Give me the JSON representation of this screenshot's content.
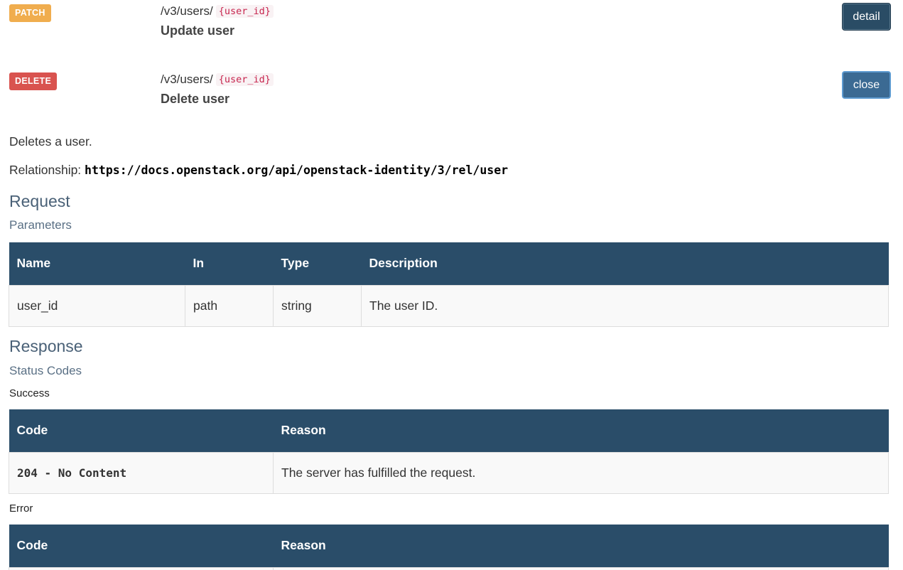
{
  "endpoints": [
    {
      "method": "PATCH",
      "path_prefix": "/v3/users/",
      "path_param": "{user_id}",
      "summary": "Update user",
      "button_label": "detail"
    },
    {
      "method": "DELETE",
      "path_prefix": "/v3/users/",
      "path_param": "{user_id}",
      "summary": "Delete user",
      "button_label": "close"
    }
  ],
  "detail": {
    "description": "Deletes a user.",
    "relationship_label": "Relationship:",
    "relationship_url": "https://docs.openstack.org/api/openstack-identity/3/rel/user",
    "request_heading": "Request",
    "parameters_heading": "Parameters",
    "parameters_table": {
      "headers": [
        "Name",
        "In",
        "Type",
        "Description"
      ],
      "rows": [
        [
          "user_id",
          "path",
          "string",
          "The user ID."
        ]
      ]
    },
    "response_heading": "Response",
    "status_codes_heading": "Status Codes",
    "success_label": "Success",
    "success_table": {
      "headers": [
        "Code",
        "Reason"
      ],
      "rows": [
        [
          "204 - No Content",
          "The server has fulfilled the request."
        ]
      ]
    },
    "error_label": "Error",
    "error_table": {
      "headers": [
        "Code",
        "Reason"
      ]
    }
  },
  "colors": {
    "patch": "#f0ad4e",
    "delete": "#d9534f",
    "table_header": "#2a4d69",
    "button_detail": "#2a4c65",
    "button_close": "#3b6a93"
  }
}
